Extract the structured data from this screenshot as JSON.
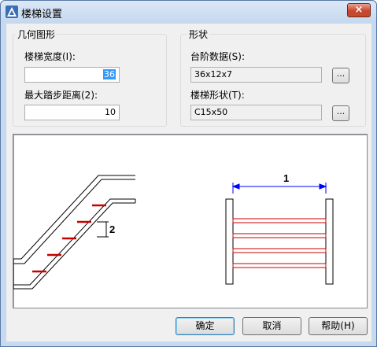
{
  "window": {
    "title": "楼梯设置",
    "close_label": "×"
  },
  "geometry_group": {
    "title": "几何图形",
    "stair_width_label": "楼梯宽度(I):",
    "stair_width_value": "36",
    "step_distance_label": "最大踏步距离(2):",
    "step_distance_value": "10"
  },
  "shape_group": {
    "title": "形状",
    "step_data_label": "台阶数据(S):",
    "step_data_value": "36x12x7",
    "step_data_browse": "...",
    "stair_shape_label": "楼梯形状(T):",
    "stair_shape_value": "C15x50",
    "stair_shape_browse": "..."
  },
  "preview": {
    "dimension_1": "1",
    "dimension_2": "2"
  },
  "buttons": {
    "ok": "确定",
    "cancel": "取消",
    "help": "帮助(H)"
  },
  "colors": {
    "accent_red": "#c80000",
    "dimension_blue": "#0000ff"
  }
}
